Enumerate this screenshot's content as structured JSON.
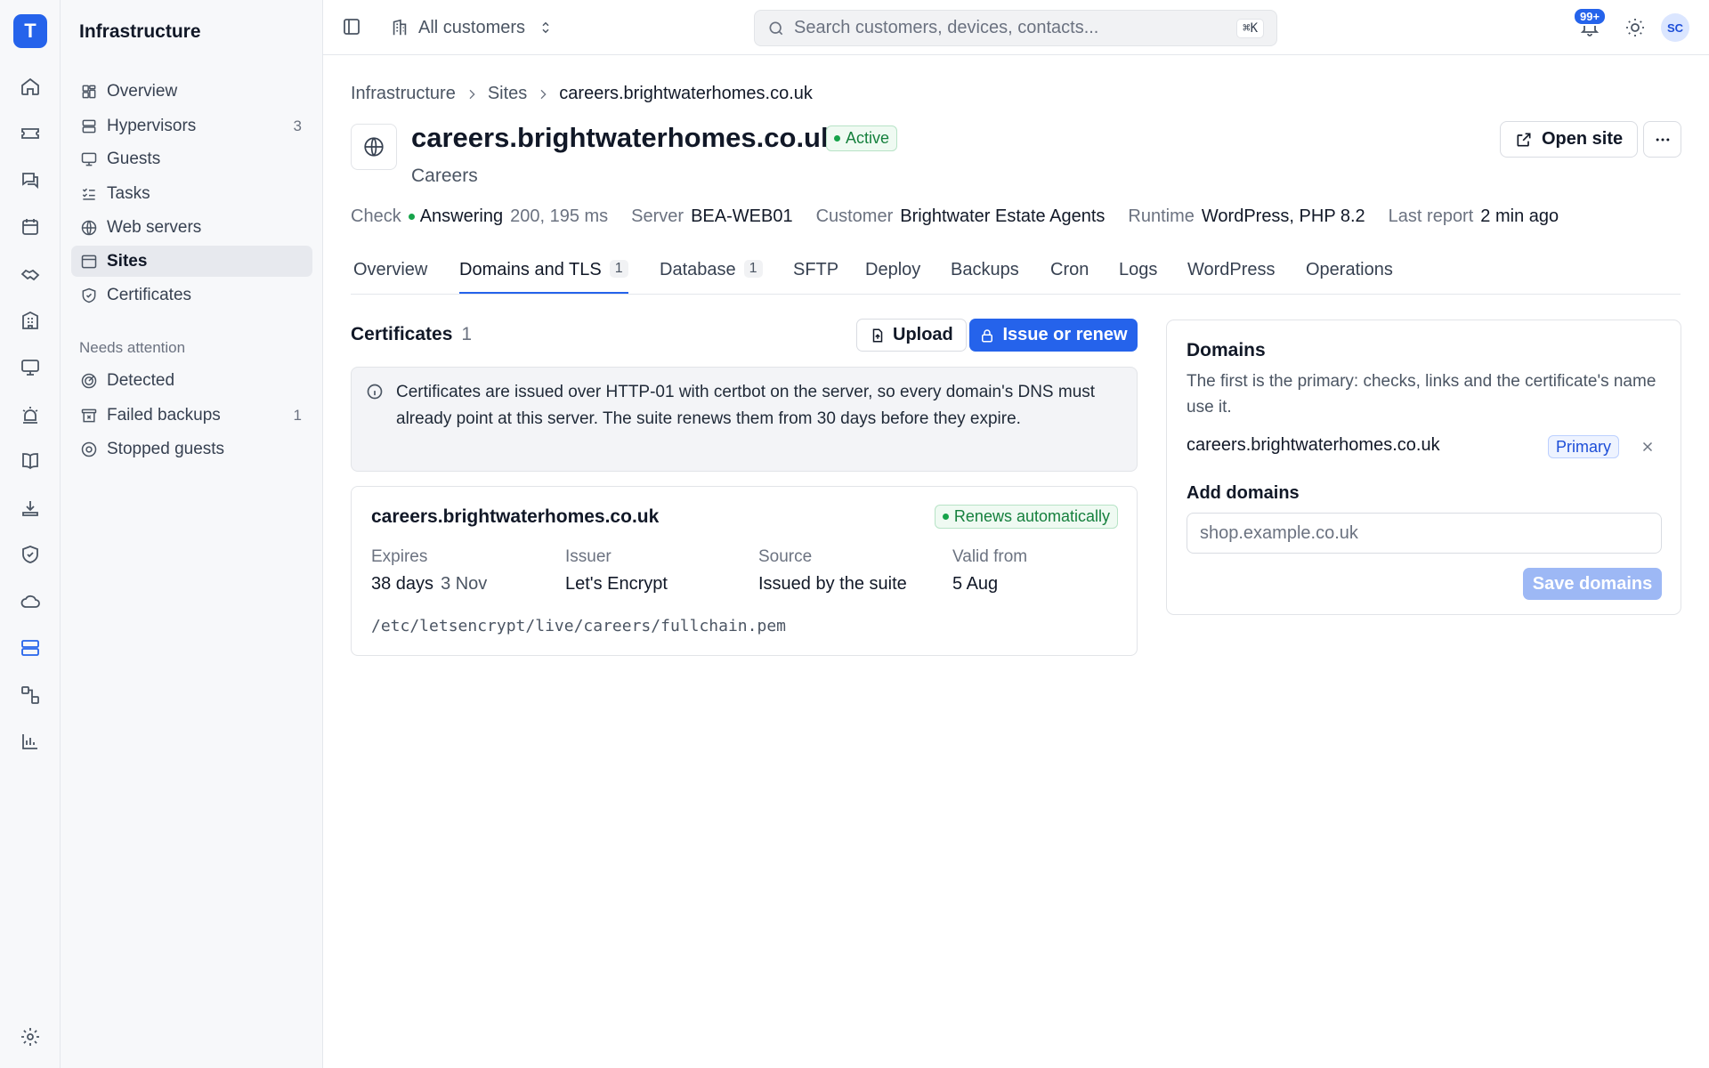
{
  "rail": {
    "logo": "T"
  },
  "sidebar": {
    "title": "Infrastructure",
    "items": [
      {
        "label": "Overview",
        "count": ""
      },
      {
        "label": "Hypervisors",
        "count": "3"
      },
      {
        "label": "Guests",
        "count": ""
      },
      {
        "label": "Tasks",
        "count": ""
      },
      {
        "label": "Web servers",
        "count": ""
      },
      {
        "label": "Sites",
        "count": ""
      },
      {
        "label": "Certificates",
        "count": ""
      }
    ],
    "section_label": "Needs attention",
    "attention_items": [
      {
        "label": "Detected",
        "count": ""
      },
      {
        "label": "Failed backups",
        "count": "1"
      },
      {
        "label": "Stopped guests",
        "count": ""
      }
    ]
  },
  "topbar": {
    "customer_selector": "All customers",
    "search_placeholder": "Search customers, devices, contacts...",
    "search_shortcut": "⌘K",
    "notification_badge": "99+",
    "avatar_initials": "SC"
  },
  "breadcrumb": [
    "Infrastructure",
    "Sites",
    "careers.brightwaterhomes.co.uk"
  ],
  "site": {
    "title": "careers.brightwaterhomes.co.uk",
    "status": "Active",
    "subtitle": "Careers",
    "open_button": "Open site",
    "more_button": "···"
  },
  "meta": {
    "check_label": "Check",
    "check_value": "Answering",
    "check_detail": "200, 195 ms",
    "server_label": "Server",
    "server_value": "BEA-WEB01",
    "customer_label": "Customer",
    "customer_value": "Brightwater Estate Agents",
    "runtime_label": "Runtime",
    "runtime_value": "WordPress, PHP 8.2",
    "report_label": "Last report",
    "report_value": "2 min ago"
  },
  "tabs": [
    {
      "label": "Overview",
      "count": ""
    },
    {
      "label": "Domains and TLS",
      "count": "1"
    },
    {
      "label": "Database",
      "count": "1"
    },
    {
      "label": "SFTP",
      "count": ""
    },
    {
      "label": "Deploy",
      "count": ""
    },
    {
      "label": "Backups",
      "count": ""
    },
    {
      "label": "Cron",
      "count": ""
    },
    {
      "label": "Logs",
      "count": ""
    },
    {
      "label": "WordPress",
      "count": ""
    },
    {
      "label": "Operations",
      "count": ""
    }
  ],
  "certificates": {
    "heading": "Certificates",
    "count": "1",
    "upload_button": "Upload",
    "issue_button": "Issue or renew",
    "info_text": "Certificates are issued over HTTP-01 with certbot on the server, so every domain's DNS must already point at this server. The suite renews them from 30 days before they expire.",
    "card": {
      "name": "careers.brightwaterhomes.co.uk",
      "renew_status": "Renews automatically",
      "expires_label": "Expires",
      "expires_value": "38 days",
      "expires_date": "3 Nov",
      "issuer_label": "Issuer",
      "issuer_value": "Let's Encrypt",
      "source_label": "Source",
      "source_value": "Issued by the suite",
      "valid_label": "Valid from",
      "valid_value": "5 Aug",
      "path": "/etc/letsencrypt/live/careers/fullchain.pem"
    }
  },
  "domains": {
    "title": "Domains",
    "description": "The first is the primary: checks, links and the certificate's name use it.",
    "primary_domain": "careers.brightwaterhomes.co.uk",
    "primary_tag": "Primary",
    "add_label": "Add domains",
    "add_placeholder": "shop.example.co.uk",
    "save_button": "Save domains"
  },
  "colors": {
    "accent": "#2563eb",
    "success": "#16a34a",
    "sidebar_bg": "#f7f8fa"
  }
}
